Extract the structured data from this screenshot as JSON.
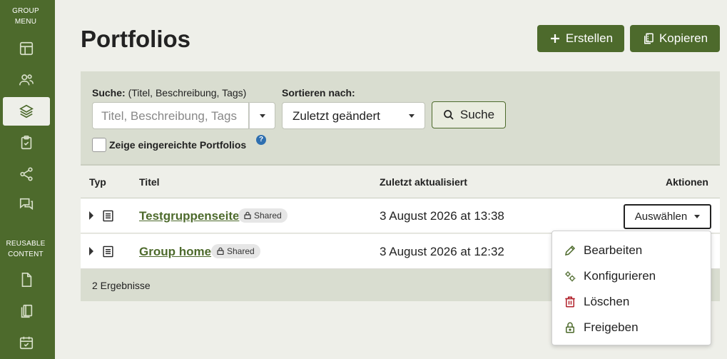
{
  "sidebar": {
    "group_heading": "GROUP MENU",
    "group_heading_line1": "GROUP",
    "group_heading_line2": "MENU",
    "reusable_heading_line1": "REUSABLE",
    "reusable_heading_line2": "CONTENT",
    "group_icons": [
      "dashboard-icon",
      "members-icon",
      "layers-icon",
      "clipboard-check-icon",
      "share-icon",
      "forum-icon"
    ],
    "active_icon": "layers-icon",
    "reusable_icons": [
      "file-icon",
      "copy-pages-icon",
      "calendar-check-icon"
    ]
  },
  "header": {
    "title": "Portfolios",
    "create_label": "Erstellen",
    "copy_label": "Kopieren"
  },
  "filter": {
    "search_label": "Suche:",
    "search_hint": "(Titel, Beschreibung, Tags)",
    "search_placeholder": "Titel, Beschreibung, Tags",
    "sort_label": "Sortieren nach:",
    "sort_value": "Zuletzt geändert",
    "search_button": "Suche",
    "checkbox_label": "Zeige eingereichte Portfolios",
    "help": "?"
  },
  "table": {
    "columns": {
      "type": "Typ",
      "title": "Titel",
      "updated": "Zuletzt aktualisiert",
      "actions": "Aktionen"
    },
    "rows": [
      {
        "title": "Testgruppenseite",
        "badge": "Shared",
        "updated": "3 August 2026 at 13:38"
      },
      {
        "title": "Group home",
        "badge": "Shared",
        "updated": "3 August 2026 at 12:32"
      }
    ],
    "choose_label": "Auswählen",
    "results": "2 Ergebnisse"
  },
  "menu": {
    "items": [
      {
        "label": "Bearbeiten",
        "icon": "pencil-icon"
      },
      {
        "label": "Konfigurieren",
        "icon": "cogs-icon"
      },
      {
        "label": "Löschen",
        "icon": "trash-icon"
      },
      {
        "label": "Freigeben",
        "icon": "lock-icon"
      }
    ]
  },
  "colors": {
    "brand": "#4d6a2c",
    "danger": "#b0212b",
    "panel": "#d9ddd0",
    "background": "#eeefe9"
  }
}
